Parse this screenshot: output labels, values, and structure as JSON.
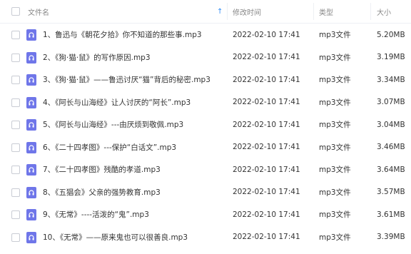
{
  "header": {
    "name_label": "文件名",
    "time_label": "修改时间",
    "type_label": "类型",
    "size_label": "大小"
  },
  "rows": [
    {
      "name": "1、鲁迅与《朝花夕拾》你不知道的那些事.mp3",
      "time": "2022-02-10 17:41",
      "type": "mp3文件",
      "size": "5.20MB"
    },
    {
      "name": "2、《狗·猫·鼠》的写作原因.mp3",
      "time": "2022-02-10 17:41",
      "type": "mp3文件",
      "size": "3.19MB"
    },
    {
      "name": "3、《狗·猫·鼠》——鲁迅讨厌“猫”背后的秘密.mp3",
      "time": "2022-02-10 17:41",
      "type": "mp3文件",
      "size": "3.34MB"
    },
    {
      "name": "4、《阿长与山海经》让人讨厌的“阿长”.mp3",
      "time": "2022-02-10 17:41",
      "type": "mp3文件",
      "size": "3.07MB"
    },
    {
      "name": "5、《阿长与山海经》---由厌烦到敬佩.mp3",
      "time": "2022-02-10 17:41",
      "type": "mp3文件",
      "size": "3.04MB"
    },
    {
      "name": "6、《二十四孝图》---保护“白话文”.mp3",
      "time": "2022-02-10 17:41",
      "type": "mp3文件",
      "size": "3.46MB"
    },
    {
      "name": "7、《二十四孝图》残酷的孝道.mp3",
      "time": "2022-02-10 17:41",
      "type": "mp3文件",
      "size": "3.64MB"
    },
    {
      "name": "8、《五猖会》父亲的强势教育.mp3",
      "time": "2022-02-10 17:41",
      "type": "mp3文件",
      "size": "3.57MB"
    },
    {
      "name": "9、《无常》----活泼的“鬼”.mp3",
      "time": "2022-02-10 17:41",
      "type": "mp3文件",
      "size": "3.61MB"
    },
    {
      "name": "10、《无常》——原来鬼也可以很善良.mp3",
      "time": "2022-02-10 17:41",
      "type": "mp3文件",
      "size": "3.39MB"
    }
  ],
  "colors": {
    "accent": "#2f8cf5",
    "audio_icon": "#6f76e9"
  }
}
